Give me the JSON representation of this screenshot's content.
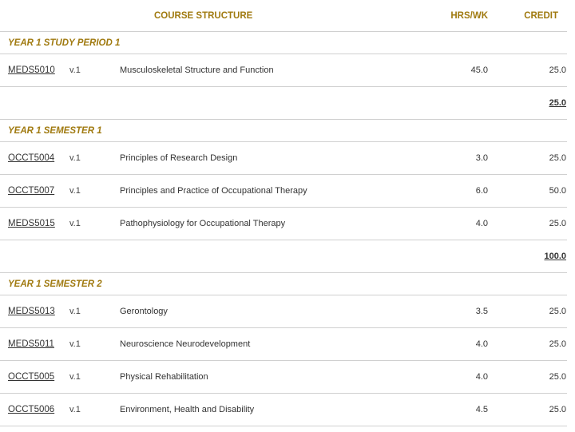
{
  "header": {
    "course_structure": "COURSE STRUCTURE",
    "hrs_wk": "HRS/WK",
    "credit": "CREDIT"
  },
  "sections": [
    {
      "title": "YEAR 1 STUDY PERIOD 1",
      "units": [
        {
          "code": "MEDS5010",
          "version": "v.1",
          "title": "Musculoskeletal Structure and Function",
          "hrs": "45.0",
          "credit": "25.0"
        }
      ],
      "subtotal": "25.0"
    },
    {
      "title": "YEAR 1 SEMESTER 1",
      "units": [
        {
          "code": "OCCT5004",
          "version": "v.1",
          "title": "Principles of Research Design",
          "hrs": "3.0",
          "credit": "25.0"
        },
        {
          "code": "OCCT5007",
          "version": "v.1",
          "title": "Principles and Practice of Occupational Therapy",
          "hrs": "6.0",
          "credit": "50.0"
        },
        {
          "code": "MEDS5015",
          "version": "v.1",
          "title": "Pathophysiology for Occupational Therapy",
          "hrs": "4.0",
          "credit": "25.0"
        }
      ],
      "subtotal": "100.0"
    },
    {
      "title": "YEAR 1 SEMESTER 2",
      "units": [
        {
          "code": "MEDS5013",
          "version": "v.1",
          "title": "Gerontology",
          "hrs": "3.5",
          "credit": "25.0"
        },
        {
          "code": "MEDS5011",
          "version": "v.1",
          "title": "Neuroscience Neurodevelopment",
          "hrs": "4.0",
          "credit": "25.0"
        },
        {
          "code": "OCCT5005",
          "version": "v.1",
          "title": "Physical Rehabilitation",
          "hrs": "4.0",
          "credit": "25.0"
        },
        {
          "code": "OCCT5006",
          "version": "v.1",
          "title": "Environment, Health and Disability",
          "hrs": "4.5",
          "credit": "25.0"
        }
      ]
    }
  ],
  "colors": {
    "accent": "#a07a10",
    "text": "#333333",
    "rule": "#d0d0d0"
  }
}
